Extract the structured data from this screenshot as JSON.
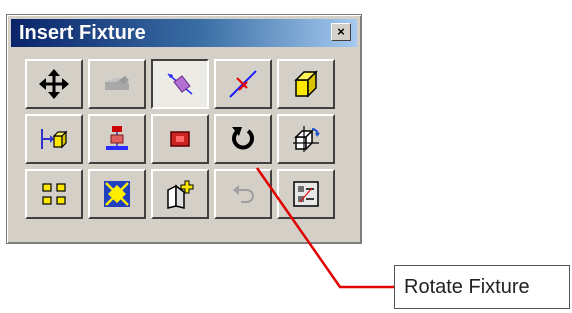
{
  "window": {
    "title": "Insert Fixture",
    "close_glyph": "×"
  },
  "toolbar": {
    "buttons": [
      {
        "icon": "move-arrows-icon",
        "state": "normal"
      },
      {
        "icon": "disabled-fixture-icon",
        "state": "disabled"
      },
      {
        "icon": "fixture-plane-icon",
        "state": "pressed"
      },
      {
        "icon": "axis-line-icon",
        "state": "normal"
      },
      {
        "icon": "yellow-box-icon",
        "state": "normal"
      },
      {
        "icon": "align-to-face-icon",
        "state": "normal"
      },
      {
        "icon": "stacked-fixture-icon",
        "state": "normal"
      },
      {
        "icon": "red-square-icon",
        "state": "normal"
      },
      {
        "icon": "rotate-fixture-icon",
        "state": "normal"
      },
      {
        "icon": "rotate-box-arrows-icon",
        "state": "normal"
      },
      {
        "icon": "array-grid-icon",
        "state": "normal"
      },
      {
        "icon": "expand-fixture-icon",
        "state": "normal"
      },
      {
        "icon": "add-fixture-icon",
        "state": "normal"
      },
      {
        "icon": "undo-disabled-icon",
        "state": "disabled"
      },
      {
        "icon": "fixture-list-icon",
        "state": "normal"
      }
    ]
  },
  "callout": {
    "label": "Rotate Fixture",
    "line_color": "#e00000"
  }
}
